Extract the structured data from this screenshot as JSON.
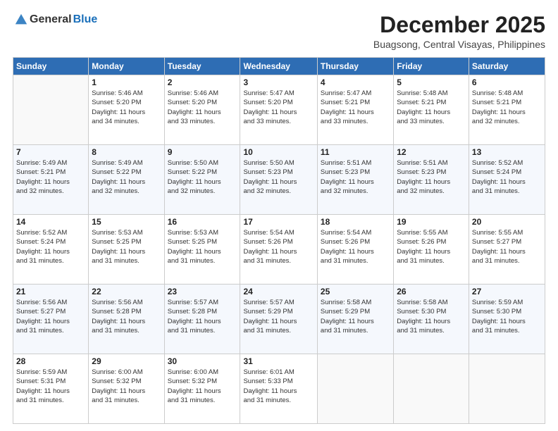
{
  "header": {
    "logo_general": "General",
    "logo_blue": "Blue",
    "month": "December 2025",
    "location": "Buagsong, Central Visayas, Philippines"
  },
  "days_of_week": [
    "Sunday",
    "Monday",
    "Tuesday",
    "Wednesday",
    "Thursday",
    "Friday",
    "Saturday"
  ],
  "weeks": [
    [
      {
        "day": "",
        "info": ""
      },
      {
        "day": "1",
        "info": "Sunrise: 5:46 AM\nSunset: 5:20 PM\nDaylight: 11 hours\nand 34 minutes."
      },
      {
        "day": "2",
        "info": "Sunrise: 5:46 AM\nSunset: 5:20 PM\nDaylight: 11 hours\nand 33 minutes."
      },
      {
        "day": "3",
        "info": "Sunrise: 5:47 AM\nSunset: 5:20 PM\nDaylight: 11 hours\nand 33 minutes."
      },
      {
        "day": "4",
        "info": "Sunrise: 5:47 AM\nSunset: 5:21 PM\nDaylight: 11 hours\nand 33 minutes."
      },
      {
        "day": "5",
        "info": "Sunrise: 5:48 AM\nSunset: 5:21 PM\nDaylight: 11 hours\nand 33 minutes."
      },
      {
        "day": "6",
        "info": "Sunrise: 5:48 AM\nSunset: 5:21 PM\nDaylight: 11 hours\nand 32 minutes."
      }
    ],
    [
      {
        "day": "7",
        "info": "Sunrise: 5:49 AM\nSunset: 5:21 PM\nDaylight: 11 hours\nand 32 minutes."
      },
      {
        "day": "8",
        "info": "Sunrise: 5:49 AM\nSunset: 5:22 PM\nDaylight: 11 hours\nand 32 minutes."
      },
      {
        "day": "9",
        "info": "Sunrise: 5:50 AM\nSunset: 5:22 PM\nDaylight: 11 hours\nand 32 minutes."
      },
      {
        "day": "10",
        "info": "Sunrise: 5:50 AM\nSunset: 5:23 PM\nDaylight: 11 hours\nand 32 minutes."
      },
      {
        "day": "11",
        "info": "Sunrise: 5:51 AM\nSunset: 5:23 PM\nDaylight: 11 hours\nand 32 minutes."
      },
      {
        "day": "12",
        "info": "Sunrise: 5:51 AM\nSunset: 5:23 PM\nDaylight: 11 hours\nand 32 minutes."
      },
      {
        "day": "13",
        "info": "Sunrise: 5:52 AM\nSunset: 5:24 PM\nDaylight: 11 hours\nand 31 minutes."
      }
    ],
    [
      {
        "day": "14",
        "info": "Sunrise: 5:52 AM\nSunset: 5:24 PM\nDaylight: 11 hours\nand 31 minutes."
      },
      {
        "day": "15",
        "info": "Sunrise: 5:53 AM\nSunset: 5:25 PM\nDaylight: 11 hours\nand 31 minutes."
      },
      {
        "day": "16",
        "info": "Sunrise: 5:53 AM\nSunset: 5:25 PM\nDaylight: 11 hours\nand 31 minutes."
      },
      {
        "day": "17",
        "info": "Sunrise: 5:54 AM\nSunset: 5:26 PM\nDaylight: 11 hours\nand 31 minutes."
      },
      {
        "day": "18",
        "info": "Sunrise: 5:54 AM\nSunset: 5:26 PM\nDaylight: 11 hours\nand 31 minutes."
      },
      {
        "day": "19",
        "info": "Sunrise: 5:55 AM\nSunset: 5:26 PM\nDaylight: 11 hours\nand 31 minutes."
      },
      {
        "day": "20",
        "info": "Sunrise: 5:55 AM\nSunset: 5:27 PM\nDaylight: 11 hours\nand 31 minutes."
      }
    ],
    [
      {
        "day": "21",
        "info": "Sunrise: 5:56 AM\nSunset: 5:27 PM\nDaylight: 11 hours\nand 31 minutes."
      },
      {
        "day": "22",
        "info": "Sunrise: 5:56 AM\nSunset: 5:28 PM\nDaylight: 11 hours\nand 31 minutes."
      },
      {
        "day": "23",
        "info": "Sunrise: 5:57 AM\nSunset: 5:28 PM\nDaylight: 11 hours\nand 31 minutes."
      },
      {
        "day": "24",
        "info": "Sunrise: 5:57 AM\nSunset: 5:29 PM\nDaylight: 11 hours\nand 31 minutes."
      },
      {
        "day": "25",
        "info": "Sunrise: 5:58 AM\nSunset: 5:29 PM\nDaylight: 11 hours\nand 31 minutes."
      },
      {
        "day": "26",
        "info": "Sunrise: 5:58 AM\nSunset: 5:30 PM\nDaylight: 11 hours\nand 31 minutes."
      },
      {
        "day": "27",
        "info": "Sunrise: 5:59 AM\nSunset: 5:30 PM\nDaylight: 11 hours\nand 31 minutes."
      }
    ],
    [
      {
        "day": "28",
        "info": "Sunrise: 5:59 AM\nSunset: 5:31 PM\nDaylight: 11 hours\nand 31 minutes."
      },
      {
        "day": "29",
        "info": "Sunrise: 6:00 AM\nSunset: 5:32 PM\nDaylight: 11 hours\nand 31 minutes."
      },
      {
        "day": "30",
        "info": "Sunrise: 6:00 AM\nSunset: 5:32 PM\nDaylight: 11 hours\nand 31 minutes."
      },
      {
        "day": "31",
        "info": "Sunrise: 6:01 AM\nSunset: 5:33 PM\nDaylight: 11 hours\nand 31 minutes."
      },
      {
        "day": "",
        "info": ""
      },
      {
        "day": "",
        "info": ""
      },
      {
        "day": "",
        "info": ""
      }
    ]
  ]
}
